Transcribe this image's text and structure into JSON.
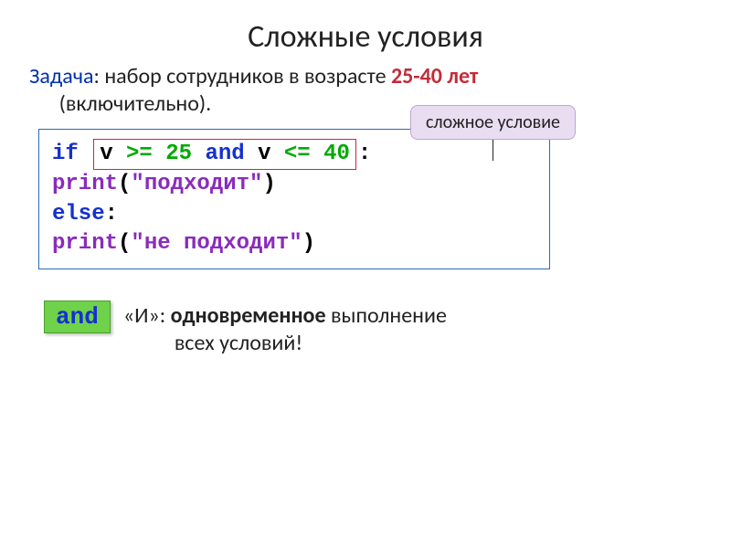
{
  "title": "Сложные условия",
  "task": {
    "label": "Задача",
    "text1": ": набор сотрудников в возрасте ",
    "ages": "25-40 лет",
    "text2": " (включительно).",
    "indent": "        "
  },
  "callout": "сложное условие",
  "code": {
    "if_kw": "if",
    "cond_var1": "v ",
    "cond_op1": ">= ",
    "cond_num1": "25",
    "cond_and": " and ",
    "cond_var2": "v ",
    "cond_op2": "<= ",
    "cond_num2": "40",
    "colon1": ":",
    "indent": "  ",
    "print1": "print",
    "paren_open1": "(",
    "str1": "\"подходит\"",
    "paren_close1": ")",
    "else_kw": "else",
    "colon2": ":",
    "print2": "print",
    "paren_open2": "(",
    "str2": "\"не подходит\"",
    "paren_close2": ")"
  },
  "and_block": {
    "badge": "and",
    "prefix": "«И»: ",
    "bold": "одновременное",
    "rest": " выполнение",
    "line2": "всех условий!"
  }
}
